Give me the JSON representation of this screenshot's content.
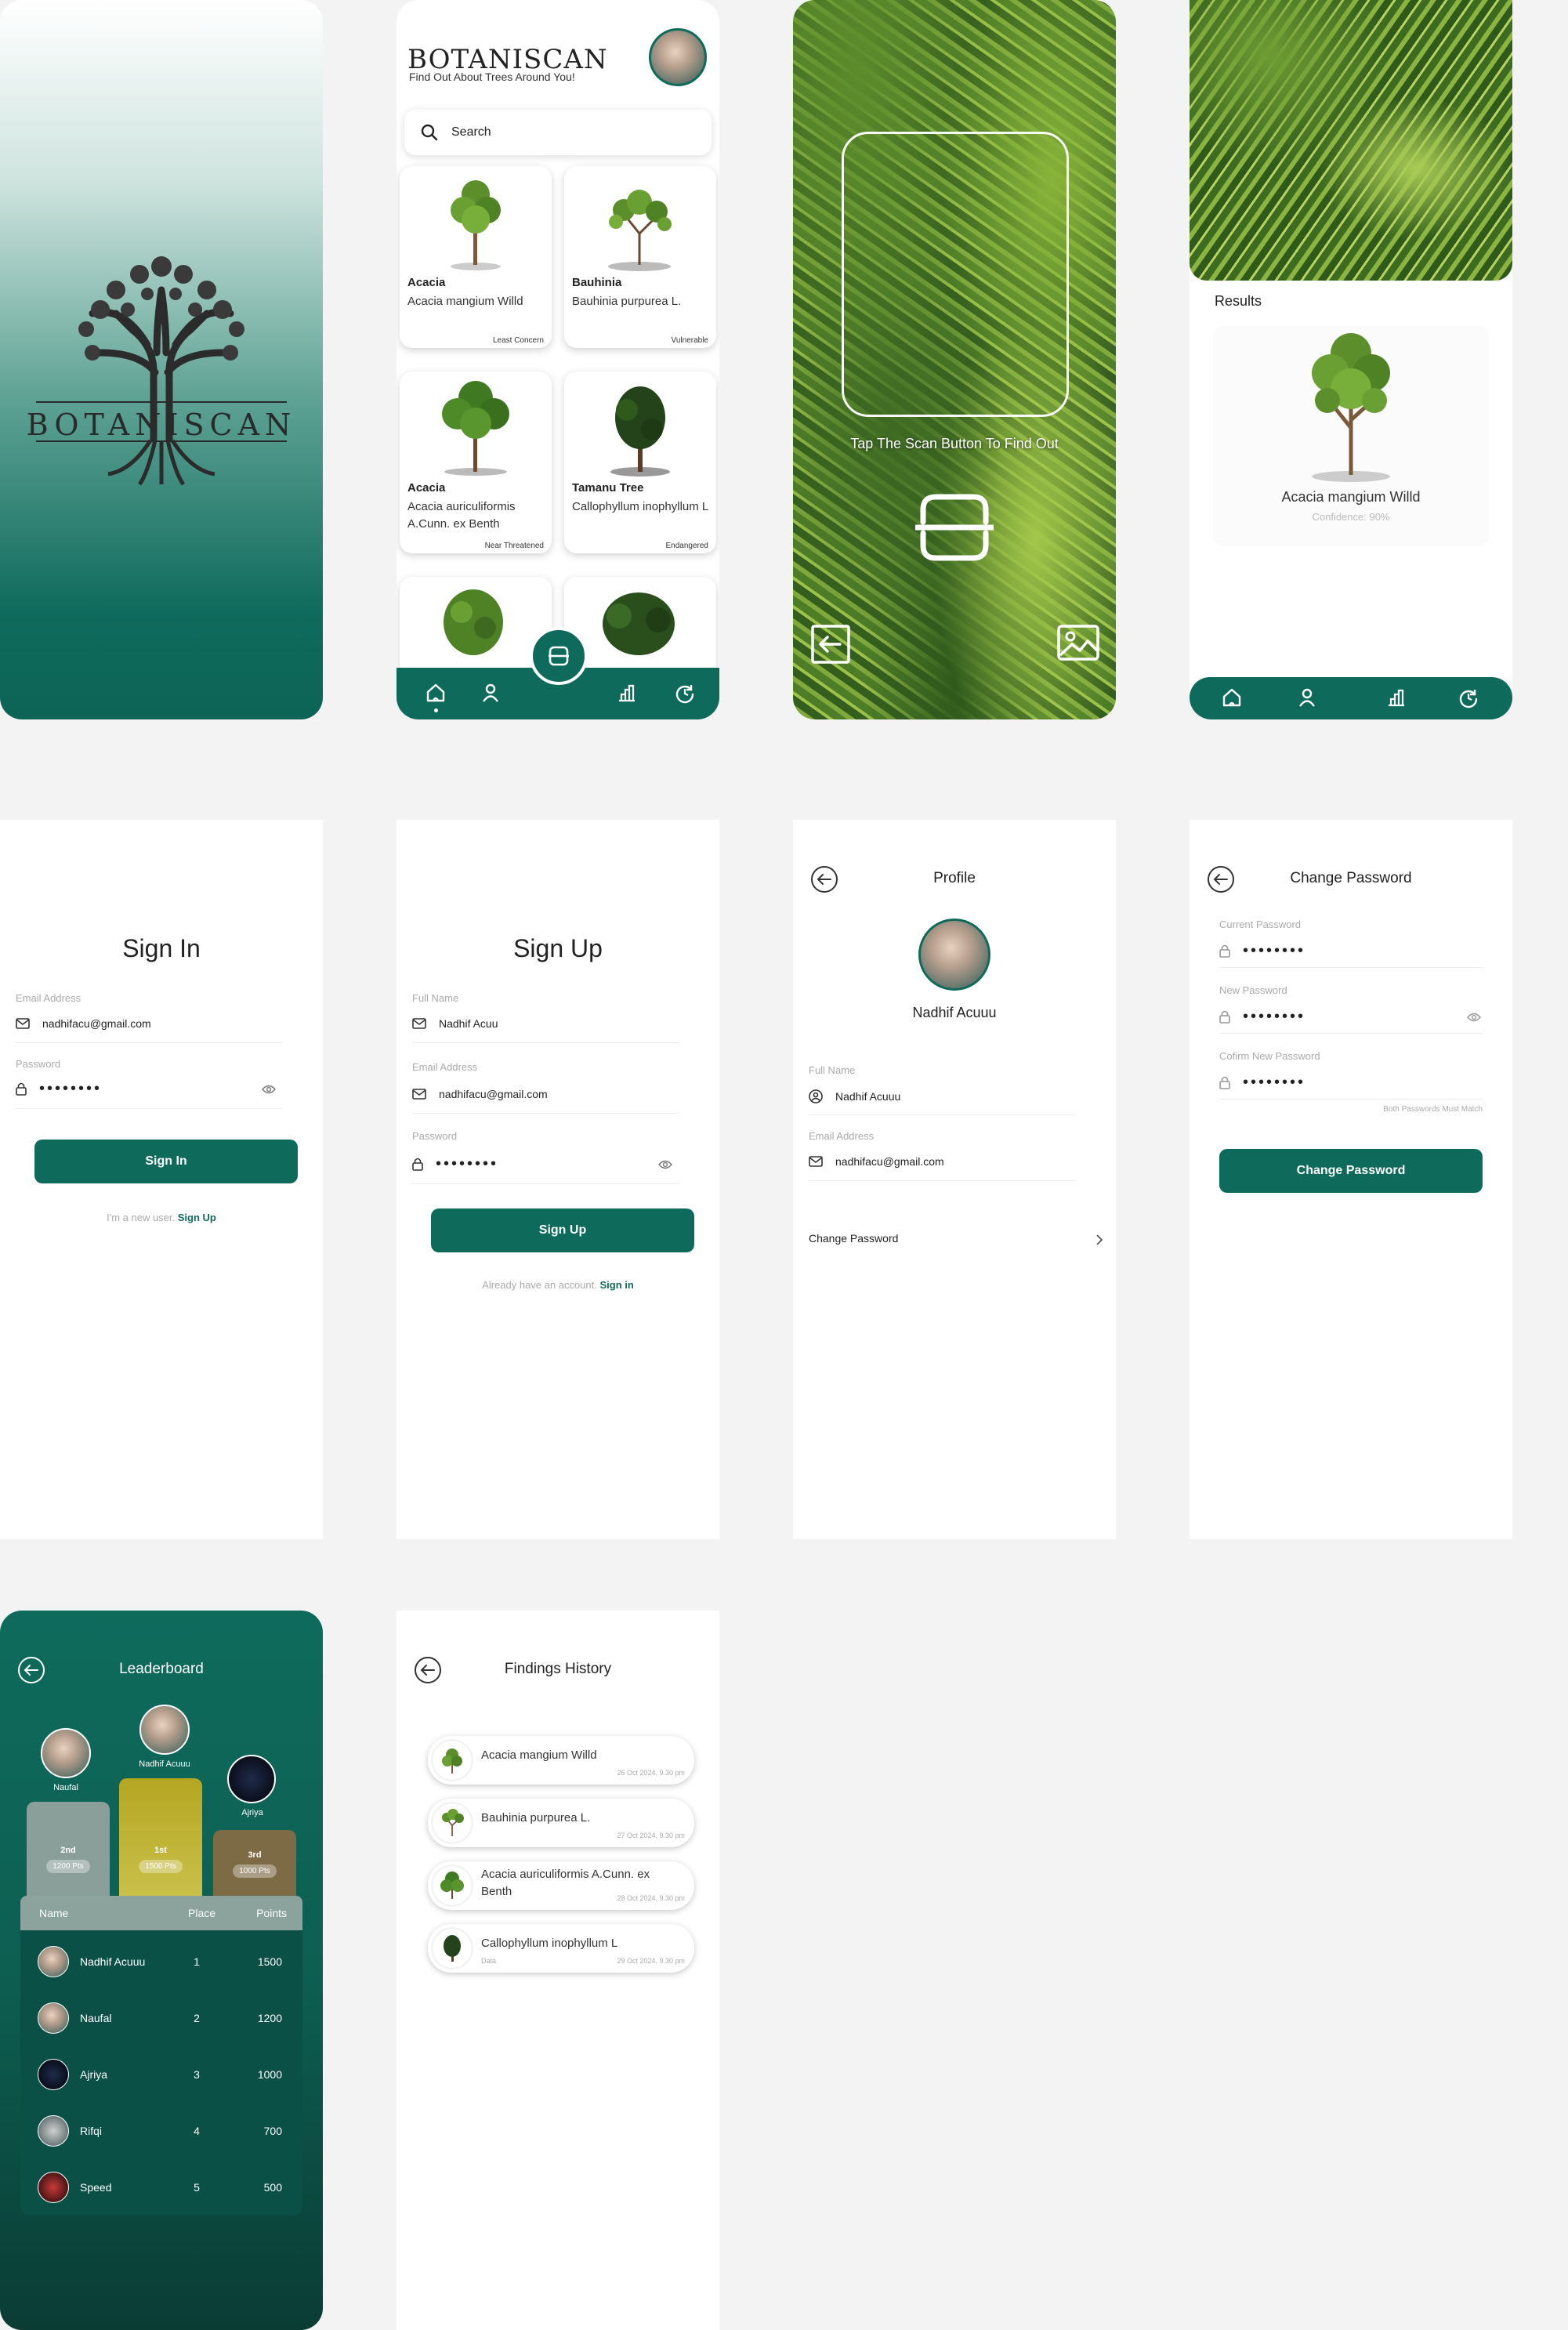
{
  "colors": {
    "brand": "#0e6b5c",
    "background": "#f3f3f3"
  },
  "splash": {
    "brand": "BOTANISCAN"
  },
  "home": {
    "title": "BOTANISCAN",
    "subtitle": "Find Out About Trees Around You!",
    "search_placeholder": "Search",
    "cards": [
      {
        "name": "Acacia",
        "scientific": "Acacia mangium Willd",
        "status": "Least Concern"
      },
      {
        "name": "Bauhinia",
        "scientific": "Bauhinia purpurea L.",
        "status": "Vulnerable"
      },
      {
        "name": "Acacia",
        "scientific": "Acacia auriculiformis A.Cunn. ex Benth",
        "status": "Near Threatened"
      },
      {
        "name": "Tamanu Tree",
        "scientific": "Callophyllum inophyllum L",
        "status": "Endangered"
      }
    ],
    "nav_icons": [
      "home-icon",
      "user-icon",
      "chart-icon",
      "history-icon",
      "scan-icon"
    ]
  },
  "scan": {
    "hint": "Tap The Scan Button To Find Out",
    "icons": [
      "back-arrow-icon",
      "scan-icon",
      "gallery-icon"
    ]
  },
  "results": {
    "label": "Results",
    "name": "Acacia mangium Willd",
    "confidence": "Confidence: 90%"
  },
  "signin": {
    "title": "Sign In",
    "email_label": "Email Address",
    "email_value": "nadhifacu@gmail.com",
    "password_label": "Password",
    "password_value": "••••••••",
    "button": "Sign In",
    "alt_text": "I'm a new user.",
    "alt_link": "Sign Up"
  },
  "signup": {
    "title": "Sign Up",
    "name_label": "Full Name",
    "name_value": "Nadhif Acuu",
    "email_label": "Email Address",
    "email_value": "nadhifacu@gmail.com",
    "password_label": "Password",
    "password_value": "••••••••",
    "button": "Sign Up",
    "alt_text": "Already have an account.",
    "alt_link": "Sign in"
  },
  "profile": {
    "title": "Profile",
    "user": "Nadhif Acuuu",
    "name_label": "Full Name",
    "name_value": "Nadhif Acuuu",
    "email_label": "Email Address",
    "email_value": "nadhifacu@gmail.com",
    "change_password": "Change Password"
  },
  "change_password": {
    "title": "Change Password",
    "current_label": "Current Password",
    "current_value": "••••••••",
    "new_label": "New Password",
    "new_value": "••••••••",
    "confirm_label": "Cofirm New Password",
    "confirm_value": "••••••••",
    "hint": "Both Passwords Must Match",
    "button": "Change Password"
  },
  "leaderboard": {
    "title": "Leaderboard",
    "podium": [
      {
        "name": "Naufal",
        "place": "2nd",
        "points": "1200 Pts"
      },
      {
        "name": "Nadhif Acuuu",
        "place": "1st",
        "points": "1500 Pts"
      },
      {
        "name": "Ajriya",
        "place": "3rd",
        "points": "1000 Pts"
      }
    ],
    "columns": [
      "Name",
      "Place",
      "Points"
    ],
    "rows": [
      {
        "name": "Nadhif Acuuu",
        "place": "1",
        "points": "1500"
      },
      {
        "name": "Naufal",
        "place": "2",
        "points": "1200"
      },
      {
        "name": "Ajriya",
        "place": "3",
        "points": "1000"
      },
      {
        "name": "Rifqi",
        "place": "4",
        "points": "700"
      },
      {
        "name": "Speed",
        "place": "5",
        "points": "500"
      }
    ]
  },
  "history": {
    "title": "Findings History",
    "items": [
      {
        "name": "Acacia mangium Willd",
        "date": "26 Oct 2024, 9.30 pm",
        "extra": ""
      },
      {
        "name": "Bauhinia purpurea L.",
        "date": "27 Oct 2024, 9.30 pm",
        "extra": ""
      },
      {
        "name": "Acacia auriculiformis A.Cunn. ex Benth",
        "date": "28 Oct 2024, 9.30 pm",
        "extra": ""
      },
      {
        "name": "Callophyllum inophyllum L",
        "date": "29 Oct 2024, 9.30 pm",
        "extra": "Data"
      }
    ]
  }
}
